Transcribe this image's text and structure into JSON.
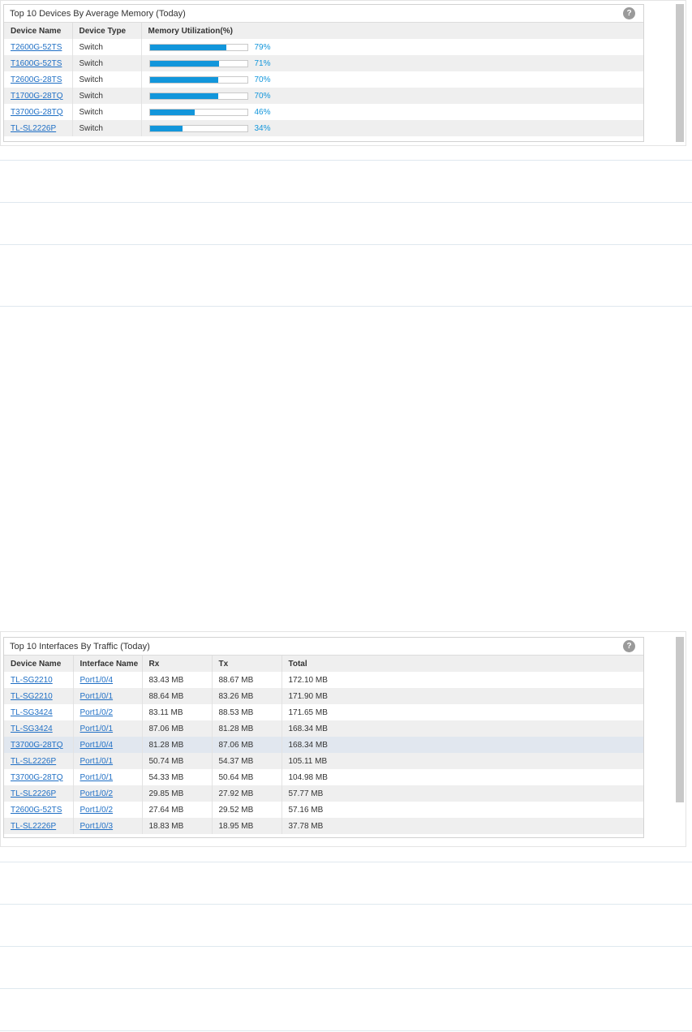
{
  "memory_widget": {
    "title": "Top 10 Devices By Average Memory (Today)",
    "help_icon": "?",
    "columns": [
      "Device Name",
      "Device Type",
      "Memory Utilization(%)"
    ],
    "rows": [
      {
        "device": "T2600G-52TS",
        "type": "Switch",
        "percent": 79,
        "label": "79%"
      },
      {
        "device": "T1600G-52TS",
        "type": "Switch",
        "percent": 71,
        "label": "71%"
      },
      {
        "device": "T2600G-28TS",
        "type": "Switch",
        "percent": 70,
        "label": "70%"
      },
      {
        "device": "T1700G-28TQ",
        "type": "Switch",
        "percent": 70,
        "label": "70%"
      },
      {
        "device": "T3700G-28TQ",
        "type": "Switch",
        "percent": 46,
        "label": "46%"
      },
      {
        "device": "TL-SL2226P",
        "type": "Switch",
        "percent": 34,
        "label": "34%"
      }
    ]
  },
  "traffic_widget": {
    "title": "Top 10 Interfaces By Traffic (Today)",
    "help_icon": "?",
    "columns": [
      "Device Name",
      "Interface Name",
      "Rx",
      "Tx",
      "Total"
    ],
    "rows": [
      {
        "device": "TL-SG2210",
        "interface": "Port1/0/4",
        "rx": "83.43 MB",
        "tx": "88.67 MB",
        "total": "172.10 MB"
      },
      {
        "device": "TL-SG2210",
        "interface": "Port1/0/1",
        "rx": "88.64 MB",
        "tx": "83.26 MB",
        "total": "171.90 MB"
      },
      {
        "device": "TL-SG3424",
        "interface": "Port1/0/2",
        "rx": "83.11 MB",
        "tx": "88.53 MB",
        "total": "171.65 MB"
      },
      {
        "device": "TL-SG3424",
        "interface": "Port1/0/1",
        "rx": "87.06 MB",
        "tx": "81.28 MB",
        "total": "168.34 MB"
      },
      {
        "device": "T3700G-28TQ",
        "interface": "Port1/0/4",
        "rx": "81.28 MB",
        "tx": "87.06 MB",
        "total": "168.34 MB"
      },
      {
        "device": "TL-SL2226P",
        "interface": "Port1/0/1",
        "rx": "50.74 MB",
        "tx": "54.37 MB",
        "total": "105.11 MB"
      },
      {
        "device": "T3700G-28TQ",
        "interface": "Port1/0/1",
        "rx": "54.33 MB",
        "tx": "50.64 MB",
        "total": "104.98 MB"
      },
      {
        "device": "TL-SL2226P",
        "interface": "Port1/0/2",
        "rx": "29.85 MB",
        "tx": "27.92 MB",
        "total": "57.77 MB"
      },
      {
        "device": "T2600G-52TS",
        "interface": "Port1/0/2",
        "rx": "27.64 MB",
        "tx": "29.52 MB",
        "total": "57.16 MB"
      },
      {
        "device": "TL-SL2226P",
        "interface": "Port1/0/3",
        "rx": "18.83 MB",
        "tx": "18.95 MB",
        "total": "37.78 MB"
      }
    ]
  },
  "colors": {
    "bar_fill": "#1296db",
    "link": "#1f6fc5",
    "row_highlight": "#e1e7ef"
  }
}
